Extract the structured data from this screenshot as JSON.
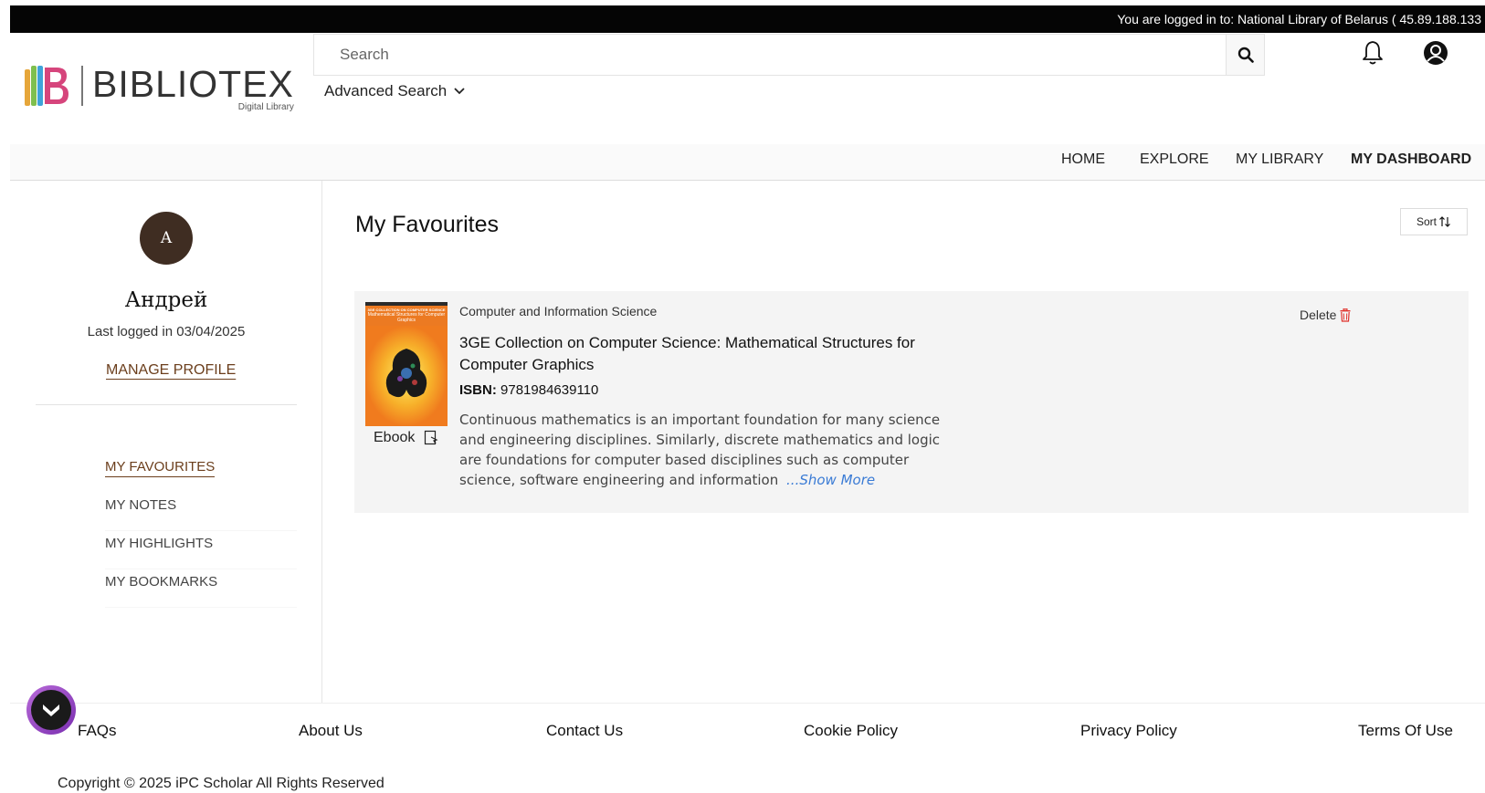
{
  "topbar": {
    "login_text": "You are logged in to: National Library of Belarus ( 45.89.188.133"
  },
  "brand": {
    "name": "BIBLIOTEX",
    "tagline": "Digital Library",
    "colors": [
      "#e6a63a",
      "#7fbf4e",
      "#3fa3d9",
      "#d6457c"
    ]
  },
  "search": {
    "placeholder": "Search",
    "value": "",
    "advanced_label": "Advanced Search"
  },
  "icons": {
    "search": "search-icon",
    "notifications": "bell-icon",
    "account": "user-circle-icon"
  },
  "nav": {
    "items": [
      {
        "label": "HOME"
      },
      {
        "label": "EXPLORE"
      },
      {
        "label": "MY LIBRARY"
      },
      {
        "label": "MY DASHBOARD",
        "active": true
      }
    ]
  },
  "profile": {
    "initial": "A",
    "name": "Андрей",
    "last_login": "Last logged in 03/04/2025",
    "manage_label": "MANAGE PROFILE"
  },
  "side_menu": {
    "items": [
      {
        "label": "MY FAVOURITES",
        "active": true
      },
      {
        "label": "MY NOTES"
      },
      {
        "label": "MY HIGHLIGHTS"
      },
      {
        "label": "MY BOOKMARKS"
      }
    ]
  },
  "main": {
    "title": "My Favourites",
    "sort_label": "Sort"
  },
  "favourites": [
    {
      "category": "Computer and Information Science",
      "title": "3GE Collection on Computer Science: Mathematical Structures for Computer Graphics",
      "isbn_label": "ISBN:",
      "isbn": "9781984639110",
      "format": "Ebook",
      "description": "Continuous mathematics is an important foundation for many science and engineering disciplines. Similarly, discrete mathematics and logic are foundations for computer based disciplines such as computer science, software engineering and information",
      "show_more": "...Show More",
      "delete_label": "Delete",
      "cover": {
        "series": "3GE COLLECTION ON COMPUTER SCIENCE",
        "title": "Mathematical Structures for Computer Graphics"
      }
    }
  ],
  "footer": {
    "links": [
      "FAQs",
      "About Us",
      "Contact Us",
      "Cookie Policy",
      "Privacy Policy",
      "Terms Of Use"
    ],
    "copyright": "Copyright © 2025 iPC Scholar All Rights Reserved"
  },
  "colors": {
    "accent_brown": "#6b3e1c",
    "avatar_bg": "#3f2d22",
    "delete_red": "#e0312b",
    "link_blue": "#3a7bd5"
  }
}
